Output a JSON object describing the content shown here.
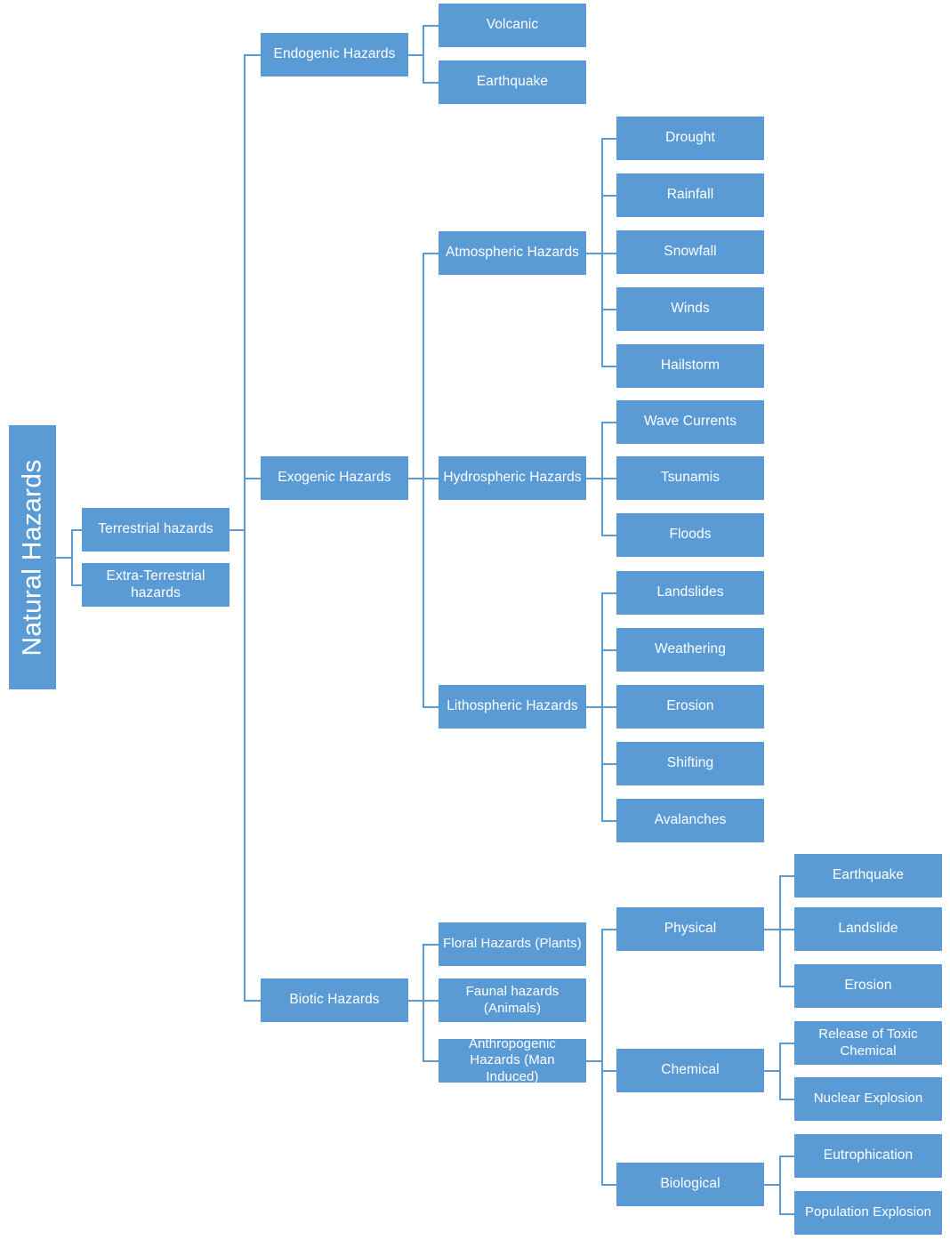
{
  "diagram": {
    "title": "Natural Hazards",
    "type": "hierarchy-tree",
    "accent_color": "#5B9BD5",
    "text_color": "#FFFFFF",
    "background_color": "#FFFFFF",
    "root": "Natural Hazards",
    "nodes": {
      "root": "Natural Hazards",
      "terrestrial": "Terrestrial hazards",
      "extra_terrestrial": "Extra-Terrestrial hazards",
      "endogenic": "Endogenic Hazards",
      "exogenic": "Exogenic Hazards",
      "biotic": "Biotic Hazards",
      "volcanic": "Volcanic",
      "earthquake_endo": "Earthquake",
      "atmospheric": "Atmospheric Hazards",
      "hydrospheric": "Hydrospheric Hazards",
      "lithospheric": "Lithospheric Hazards",
      "drought": "Drought",
      "rainfall": "Rainfall",
      "snowfall": "Snowfall",
      "winds": "Winds",
      "hailstorm": "Hailstorm",
      "wave_currents": "Wave Currents",
      "tsunamis": "Tsunamis",
      "floods": "Floods",
      "landslides": "Landslides",
      "weathering": "Weathering",
      "erosion_litho": "Erosion",
      "shifting": "Shifting",
      "avalanches": "Avalanches",
      "floral": "Floral Hazards (Plants)",
      "faunal": "Faunal hazards (Animals)",
      "anthropogenic": "Anthropogenic Hazards (Man Induced)",
      "physical": "Physical",
      "chemical": "Chemical",
      "biological": "Biological",
      "earthquake_phys": "Earthquake",
      "landslide_phys": "Landslide",
      "erosion_phys": "Erosion",
      "toxic_chemical": "Release of Toxic Chemical",
      "nuclear_explosion": "Nuclear Explosion",
      "eutrophication": "Eutrophication",
      "population_explosion": "Population Explosion"
    }
  }
}
